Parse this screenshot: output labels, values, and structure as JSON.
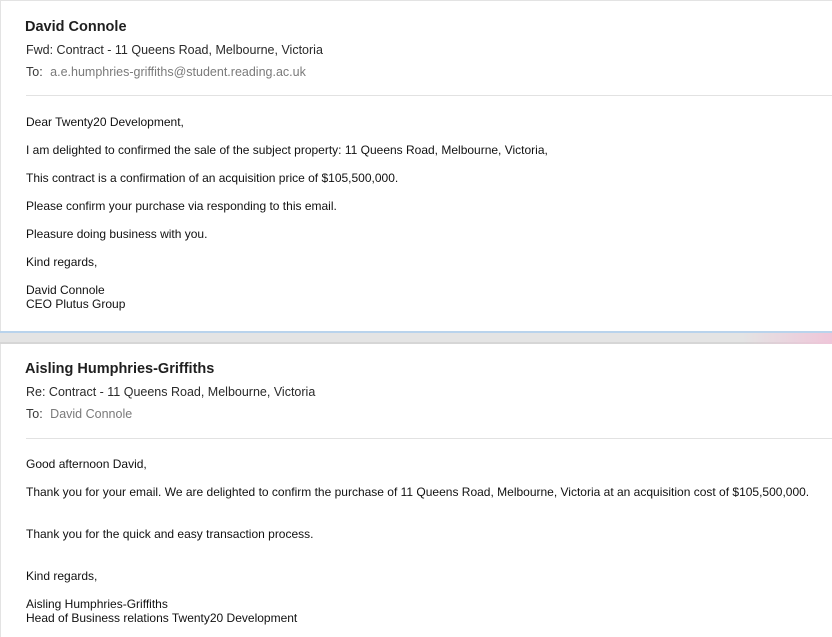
{
  "emails": [
    {
      "sender": "David Connole",
      "subject": "Fwd: Contract - 11 Queens Road, Melbourne, Victoria",
      "to_label": "To:",
      "to_value": "a.e.humphries-griffiths@student.reading.ac.uk",
      "body": {
        "greeting": "Dear Twenty20 Development,",
        "line1": "I am delighted to confirmed the sale of the subject property: 11 Queens Road, Melbourne, Victoria,",
        "line2": "This contract is a confirmation of an acquisition price of $105,500,000.",
        "line3": "Please confirm your purchase via responding to this email.",
        "line4": "Pleasure doing business with you.",
        "closing": "Kind regards,",
        "signature_name": "David Connole",
        "signature_title": "CEO Plutus Group"
      }
    },
    {
      "sender": "Aisling Humphries-Griffiths",
      "subject": "Re: Contract - 11 Queens Road, Melbourne, Victoria",
      "to_label": "To:",
      "to_value": "David Connole",
      "body": {
        "greeting": "Good afternoon David,",
        "line1": "Thank you for your email. We are delighted to confirm the purchase of 11 Queens Road, Melbourne, Victoria at an acquisition cost of $105,500,000.",
        "line2": "Thank you for the quick and easy transaction process.",
        "closing": "Kind regards,",
        "signature_name": "Aisling Humphries-Griffiths",
        "signature_title": "Head of Business relations Twenty20 Development"
      }
    }
  ]
}
